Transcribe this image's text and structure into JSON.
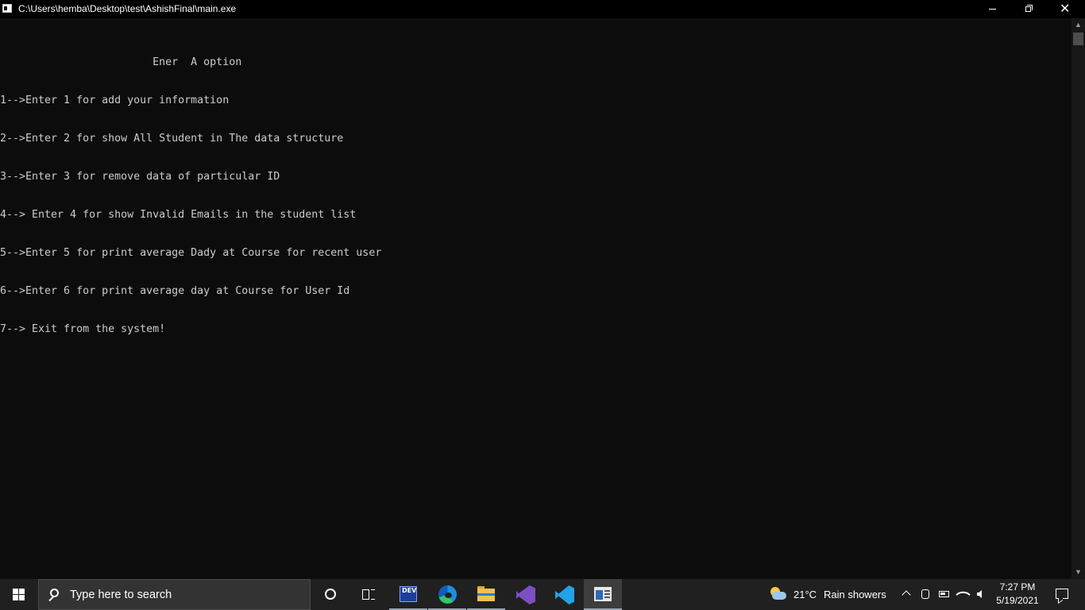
{
  "window": {
    "title": "C:\\Users\\hemba\\Desktop\\test\\AshishFinal\\main.exe",
    "minimize_icon": "minimize-icon",
    "restore_icon": "restore-icon",
    "close_icon": "close-icon",
    "close_glyph": "✕"
  },
  "console": {
    "lines": [
      "                        Ener  A option",
      "1-->Enter 1 for add your information",
      "2-->Enter 2 for show All Student in The data structure",
      "3-->Enter 3 for remove data of particular ID",
      "4--> Enter 4 for show Invalid Emails in the student list",
      "5-->Enter 5 for print average Dady at Course for recent user",
      "6-->Enter 6 for print average day at Course for User Id",
      "7--> Exit from the system!"
    ],
    "text_color": "#cccccc",
    "background": "#0c0c0c"
  },
  "scrollbar": {
    "up_glyph": "▲",
    "down_glyph": "▼"
  },
  "taskbar": {
    "search_placeholder": "Type here to search",
    "apps": [
      {
        "name": "Dev-C++",
        "icon": "devcpp-icon",
        "label": "DEV"
      },
      {
        "name": "Microsoft Edge",
        "icon": "edge-icon"
      },
      {
        "name": "File Explorer",
        "icon": "folder-icon"
      },
      {
        "name": "Visual Studio",
        "icon": "visual-studio-icon"
      },
      {
        "name": "Visual Studio Code",
        "icon": "vscode-icon"
      },
      {
        "name": "Console",
        "icon": "console-app-icon",
        "active": true
      }
    ],
    "weather": {
      "temperature": "21°C",
      "description": "Rain showers",
      "icon": "weather-rain-icon"
    },
    "clock": {
      "time": "7:27 PM",
      "date": "5/19/2021"
    },
    "accent": "#202020"
  }
}
